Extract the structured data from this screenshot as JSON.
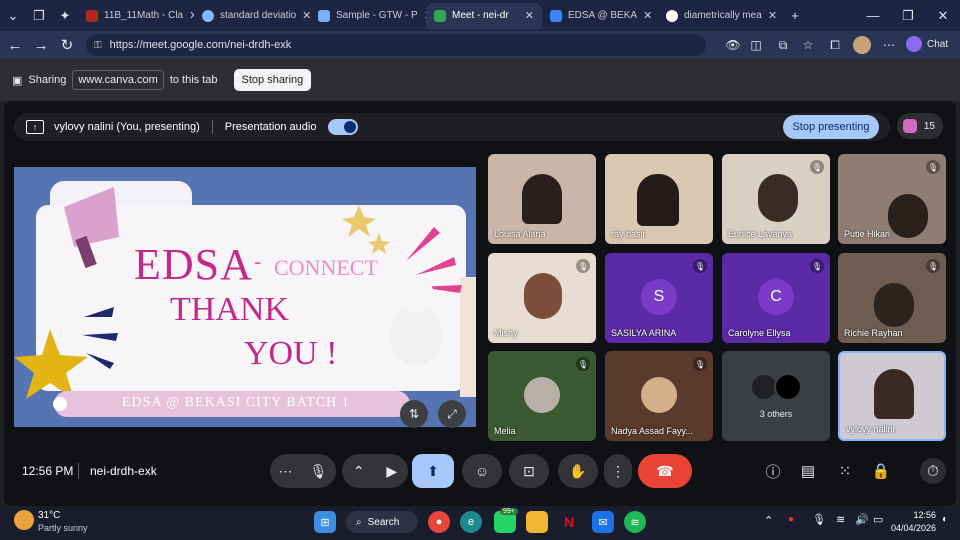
{
  "browser": {
    "tabs": [
      {
        "label": "11B_11Math - Cla",
        "favicon_color": "#b3261e"
      },
      {
        "label": "standard deviatio",
        "favicon_color": "#8ab4f8"
      },
      {
        "label": "Sample - GTW - P",
        "favicon_color": "#7bb3f5"
      },
      {
        "label": "Meet - nei-dr",
        "favicon_color": "#34a853"
      },
      {
        "label": "EDSA @ BEKA",
        "favicon_color": "#4285f4"
      },
      {
        "label": "diametrically mea",
        "favicon_color": "#ffffff"
      }
    ],
    "url": "https://meet.google.com/nei-drdh-exk",
    "chat_label": "Chat"
  },
  "share_bar": {
    "sharing_label": "Sharing",
    "site": "www.canva.com",
    "suffix": "to this tab",
    "stop_sharing": "Stop sharing"
  },
  "meet": {
    "presenter_label": "vylovy nalini (You, presenting)",
    "presentation_audio": "Presentation audio",
    "stop_presenting": "Stop presenting",
    "participant_count": "15",
    "time": "12:56 PM",
    "meeting_code": "nei-drdh-exk"
  },
  "slide": {
    "title_edsa": "EDSA",
    "dash": "-",
    "connect": "CONNECT",
    "thank": "THANK",
    "you": "YOU !",
    "banner": "EDSA @ BEKASI CITY BATCH 1"
  },
  "tiles": [
    {
      "name": "Louisa Alana",
      "muted": false,
      "bg": "#c9b6a8"
    },
    {
      "name": "ray basir",
      "muted": false,
      "bg": "#d8c7b1"
    },
    {
      "name": "Eunice Lavanya",
      "muted": true,
      "bg": "#d9cfc2"
    },
    {
      "name": "Putie Hikari",
      "muted": true,
      "bg": "#8f7c72"
    },
    {
      "name": "Mishy",
      "muted": true,
      "bg": "#e8dcd0"
    },
    {
      "name": "SASILYA ARINA",
      "muted": true,
      "bg": "#5b2aa6",
      "initial": "S",
      "avatar_color": "#7a3cc8"
    },
    {
      "name": "Carolyne Ellysa",
      "muted": true,
      "bg": "#5b2aa6",
      "initial": "C",
      "avatar_color": "#7a3cc8"
    },
    {
      "name": "Richie Rayhan",
      "muted": true,
      "bg": "#6f5d52"
    },
    {
      "name": "Melia",
      "muted": false,
      "bg": "#3b5a33"
    },
    {
      "name": "Nadya Assad Fayy...",
      "muted": true,
      "bg": "#5a3a2c"
    },
    {
      "name": "3 others",
      "muted": false,
      "bg": "#3c4043"
    },
    {
      "name": "vylovy nalini",
      "muted": false,
      "bg": "#cfcad2"
    }
  ],
  "taskbar": {
    "weather_temp": "31°C",
    "weather_desc": "Partly sunny",
    "search_label": "Search",
    "badge": "99+",
    "clock_time": "12:56",
    "clock_date": "04/04/2026"
  }
}
